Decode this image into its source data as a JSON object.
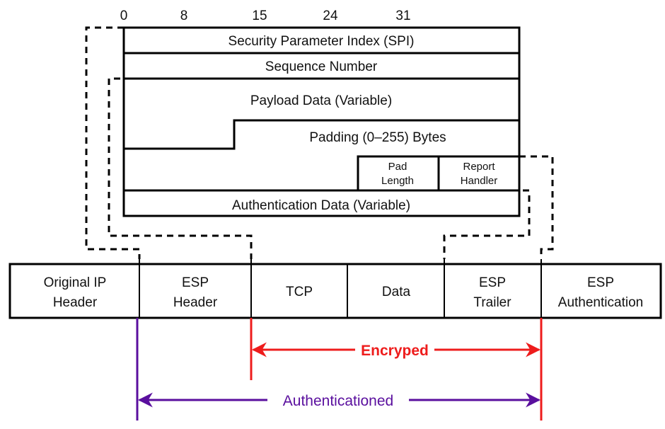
{
  "esp_format": {
    "bit_labels": [
      "0",
      "8",
      "15",
      "24",
      "31"
    ],
    "fields": {
      "spi": "Security Parameter Index (SPI)",
      "sequence": "Sequence Number",
      "payload": "Payload Data (Variable)",
      "padding": "Padding (0–255) Bytes",
      "pad_length_line1": "Pad",
      "pad_length_line2": "Length",
      "next_header_line1": "Report",
      "next_header_line2": "Handler",
      "auth_data": "Authentication Data (Variable)"
    }
  },
  "packet": {
    "segments": [
      {
        "line1": "Original IP",
        "line2": "Header"
      },
      {
        "line1": "ESP",
        "line2": "Header"
      },
      {
        "line1": "TCP",
        "line2": ""
      },
      {
        "line1": "Data",
        "line2": ""
      },
      {
        "line1": "ESP",
        "line2": "Trailer"
      },
      {
        "line1": "ESP",
        "line2": "Authentication"
      }
    ]
  },
  "ranges": {
    "encrypted": {
      "label": "Encryped",
      "color": "#ee1c1c"
    },
    "authenticated": {
      "label": "Authenticationed",
      "color": "#5a0f9e"
    }
  }
}
